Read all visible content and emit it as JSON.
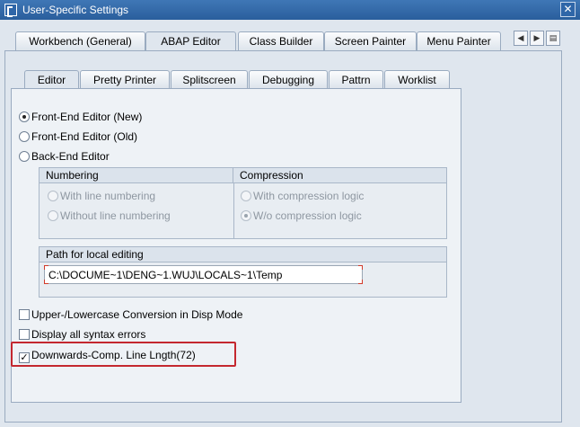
{
  "window": {
    "title": "User-Specific Settings",
    "close_glyph": "✕"
  },
  "outer_tabs": [
    {
      "label": "Workbench (General)"
    },
    {
      "label": "ABAP Editor"
    },
    {
      "label": "Class Builder"
    },
    {
      "label": "Screen Painter"
    },
    {
      "label": "Menu Painter"
    }
  ],
  "tab_nav": {
    "left": "◀",
    "right": "▶",
    "list": "▤"
  },
  "inner_tabs": [
    {
      "label": "Editor"
    },
    {
      "label": "Pretty Printer"
    },
    {
      "label": "Splitscreen"
    },
    {
      "label": "Debugging"
    },
    {
      "label": "Pattrn"
    },
    {
      "label": "Worklist"
    }
  ],
  "editor_type": {
    "options": [
      {
        "label": "Front-End Editor (New)",
        "selected": true
      },
      {
        "label": "Front-End Editor (Old)",
        "selected": false
      },
      {
        "label": "Back-End Editor",
        "selected": false
      }
    ]
  },
  "numbering": {
    "title": "Numbering",
    "options": [
      {
        "label": "With line numbering"
      },
      {
        "label": "Without line numbering"
      }
    ]
  },
  "compression": {
    "title": "Compression",
    "options": [
      {
        "label": "With compression logic"
      },
      {
        "label": "W/o compression logic"
      }
    ]
  },
  "local_editing": {
    "title": "Path for local editing",
    "path": "C:\\DOCUME~1\\DENG~1.WUJ\\LOCALS~1\\Temp"
  },
  "checkboxes": [
    {
      "label": "Upper-/Lowercase Conversion in Disp Mode",
      "mark": ""
    },
    {
      "label": "Display all syntax errors",
      "mark": ""
    },
    {
      "label": "Downwards-Comp. Line Lngth(72)",
      "mark": "✓"
    }
  ]
}
